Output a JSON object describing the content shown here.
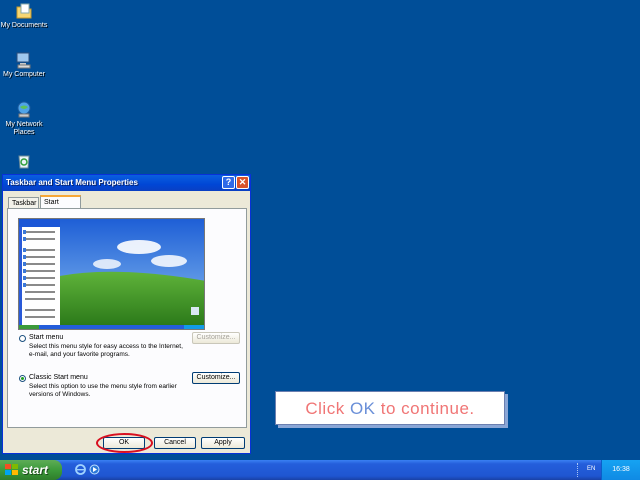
{
  "desktop": {
    "icons": [
      {
        "label": "My Documents"
      },
      {
        "label": "My Computer"
      },
      {
        "label": "My Network Places"
      },
      {
        "label": "Recycle Bin"
      }
    ]
  },
  "dialog": {
    "title": "Taskbar and Start Menu Properties",
    "help_glyph": "?",
    "close_glyph": "✕",
    "tabs": [
      {
        "label": "Taskbar",
        "active": false
      },
      {
        "label": "Start Menu",
        "active": true
      }
    ],
    "options": [
      {
        "label": "Start menu",
        "selected": false,
        "description": "Select this menu style for easy access to the Internet, e-mail, and your favorite programs.",
        "button": "Customize...",
        "button_enabled": false
      },
      {
        "label": "Classic Start menu",
        "selected": true,
        "description": "Select this option to use the menu style from earlier versions of Windows.",
        "button": "Customize...",
        "button_enabled": true
      }
    ],
    "buttons": {
      "ok": "OK",
      "cancel": "Cancel",
      "apply": "Apply"
    }
  },
  "callout": {
    "prefix": "Click ",
    "highlight": "OK",
    "suffix": " to continue."
  },
  "taskbar": {
    "start_label": "start",
    "language": "EN",
    "clock": "16:38"
  },
  "colors": {
    "desktop": "#004e98",
    "callout_text": "#f07575",
    "callout_highlight": "#6a8fd8",
    "ok_highlight_ring": "#d81020"
  }
}
